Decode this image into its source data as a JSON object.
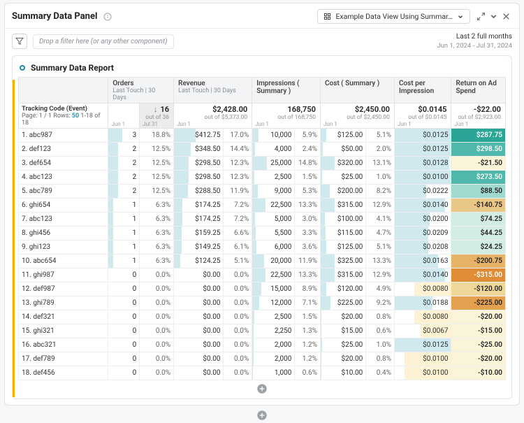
{
  "header": {
    "title": "Summary Data Panel",
    "view_btn_icon": "grid",
    "view_btn_label": "Example Data View Using Summar…"
  },
  "filter": {
    "placeholder": "Drop a filter here (or any other component)",
    "range_label": "Last 2 full months",
    "range_dates": "Jun 1, 2024 - Jul 31, 2024"
  },
  "report": {
    "title": "Summary Data Report",
    "track_label": "Tracking Code (Event)",
    "page_label_pre": "Page: 1 / 1  Rows:",
    "page_rows": "50",
    "page_label_post": "1-18 of 18",
    "sub_jun": "Jun 1",
    "sub_jul": "Jul 31"
  },
  "columns": {
    "orders": {
      "label": "Orders",
      "sub": "Last Touch | 30 Days",
      "total": "16",
      "out": "out of 36"
    },
    "revenue": {
      "label": "Revenue",
      "sub": "Last Touch | 30 Days",
      "total": "$2,428.00",
      "out": "out of $5,373.00"
    },
    "impr": {
      "label": "Impressions ( Summary )",
      "total": "168,750",
      "out": "out of 168,750"
    },
    "cost": {
      "label": "Cost ( Summary )",
      "total": "$2,450.00",
      "out": "out of $2,450.00"
    },
    "cpi": {
      "label": "Cost per Impression",
      "total": "$0.0145",
      "out": "out of $0.0145"
    },
    "roas": {
      "label": "Return on Ad Spend",
      "total": "-$22.00",
      "out": "out of $2,923.00"
    }
  },
  "rows": [
    {
      "label": "1.  abc987",
      "orders": "3",
      "orders_p": "18.8%",
      "rev": "$412.75",
      "rev_p": "17.0%",
      "imp": "10,000",
      "imp_p": "5.9%",
      "cost": "$125.00",
      "cost_p": "5.1%",
      "cpi": "$0.0125",
      "roas": "$287.75",
      "roas_c": "r-tealD",
      "bars": {
        "o": 44,
        "r": 44,
        "i": 14,
        "c": 13,
        "p": 100
      }
    },
    {
      "label": "2.  def123",
      "orders": "2",
      "orders_p": "12.5%",
      "rev": "$348.50",
      "rev_p": "14.4%",
      "imp": "4,000",
      "imp_p": "2.4%",
      "cost": "$50.00",
      "cost_p": "2.0%",
      "cpi": "$0.0125",
      "roas": "$298.50",
      "roas_c": "r-teal",
      "bars": {
        "o": 30,
        "r": 34,
        "i": 6,
        "c": 5,
        "p": 100
      }
    },
    {
      "label": "3.  def654",
      "orders": "2",
      "orders_p": "12.5%",
      "rev": "$298.50",
      "rev_p": "12.3%",
      "imp": "25,000",
      "imp_p": "14.8%",
      "cost": "$320.00",
      "cost_p": "13.1%",
      "cpi": "$0.0128",
      "roas": "-$21.50",
      "roas_c": "r-cream",
      "bars": {
        "o": 30,
        "r": 29,
        "i": 35,
        "c": 31,
        "p": 97
      }
    },
    {
      "label": "4.  abc123",
      "orders": "2",
      "orders_p": "12.5%",
      "rev": "$298.50",
      "rev_p": "12.3%",
      "imp": "2,500",
      "imp_p": "1.5%",
      "cost": "$25.00",
      "cost_p": "1.0%",
      "cpi": "$0.0100",
      "roas": "$273.50",
      "roas_c": "r-teal",
      "bars": {
        "o": 30,
        "r": 29,
        "i": 4,
        "c": 3,
        "p": 100
      }
    },
    {
      "label": "5.  abc789",
      "orders": "2",
      "orders_p": "12.5%",
      "rev": "$288.50",
      "rev_p": "11.9%",
      "imp": "9,000",
      "imp_p": "5.3%",
      "cost": "$200.00",
      "cost_p": "8.2%",
      "cpi": "$0.0222",
      "roas": "$88.50",
      "roas_c": "r-tealL",
      "bars": {
        "o": 30,
        "r": 28,
        "i": 13,
        "c": 20,
        "p": 56
      }
    },
    {
      "label": "6.  ghi654",
      "orders": "1",
      "orders_p": "6.3%",
      "rev": "$174.25",
      "rev_p": "7.2%",
      "imp": "22,500",
      "imp_p": "13.3%",
      "cost": "$315.00",
      "cost_p": "12.9%",
      "cpi": "$0.0140",
      "roas": "-$140.75",
      "roas_c": "r-tan",
      "bars": {
        "o": 15,
        "r": 17,
        "i": 31,
        "c": 31,
        "p": 89
      }
    },
    {
      "label": "7.  abc123",
      "orders": "1",
      "orders_p": "6.3%",
      "rev": "$174.25",
      "rev_p": "7.2%",
      "imp": "5,000",
      "imp_p": "3.0%",
      "cost": "$100.00",
      "cost_p": "4.1%",
      "cpi": "$0.0200",
      "roas": "$74.25",
      "roas_c": "r-mint",
      "bars": {
        "o": 15,
        "r": 17,
        "i": 7,
        "c": 10,
        "p": 62
      }
    },
    {
      "label": "8.  ghi456",
      "orders": "1",
      "orders_p": "6.3%",
      "rev": "$159.25",
      "rev_p": "6.6%",
      "imp": "5,500",
      "imp_p": "3.3%",
      "cost": "$115.00",
      "cost_p": "4.7%",
      "cpi": "$0.0209",
      "roas": "$44.25",
      "roas_c": "r-mint",
      "bars": {
        "o": 15,
        "r": 16,
        "i": 8,
        "c": 11,
        "p": 60
      }
    },
    {
      "label": "9.  ghi123",
      "orders": "1",
      "orders_p": "6.3%",
      "rev": "$149.25",
      "rev_p": "6.1%",
      "imp": "6,000",
      "imp_p": "3.6%",
      "cost": "$125.00",
      "cost_p": "5.1%",
      "cpi": "$0.0208",
      "roas": "$24.25",
      "roas_c": "r-mint",
      "bars": {
        "o": 15,
        "r": 15,
        "i": 9,
        "c": 12,
        "p": 60
      }
    },
    {
      "label": "10. abc654",
      "orders": "1",
      "orders_p": "6.3%",
      "rev": "$124.25",
      "rev_p": "5.1%",
      "imp": "20,000",
      "imp_p": "11.9%",
      "cost": "$325.00",
      "cost_p": "13.3%",
      "cpi": "$0.0163",
      "roas": "-$200.75",
      "roas_c": "r-lor",
      "bars": {
        "o": 15,
        "r": 12,
        "i": 28,
        "c": 31,
        "p": 77
      }
    },
    {
      "label": "11.  ghi987",
      "orders": "0",
      "orders_p": "0.0%",
      "rev": "$0.00",
      "rev_p": "0.0%",
      "imp": "22,500",
      "imp_p": "13.3%",
      "cost": "$315.00",
      "cost_p": "12.9%",
      "cpi": "$0.0140",
      "roas": "-$315.00",
      "roas_c": "r-orD",
      "bars": {
        "o": 0,
        "r": 0,
        "i": 31,
        "c": 31,
        "p": 89
      }
    },
    {
      "label": "12.  def987",
      "orders": "0",
      "orders_p": "0.0%",
      "rev": "$0.00",
      "rev_p": "0.0%",
      "imp": "15,000",
      "imp_p": "8.9%",
      "cost": "$120.00",
      "cost_p": "4.9%",
      "cpi": "$0.0080",
      "roas": "-$120.00",
      "roas_c": "r-sand",
      "bars": {
        "o": 0,
        "r": 0,
        "i": 21,
        "c": 12,
        "p": 100,
        "po": 35
      }
    },
    {
      "label": "13.  ghi789",
      "orders": "0",
      "orders_p": "0.0%",
      "rev": "$0.00",
      "rev_p": "0.0%",
      "imp": "12,000",
      "imp_p": "7.1%",
      "cost": "$225.00",
      "cost_p": "9.2%",
      "cpi": "$0.0188",
      "roas": "-$225.00",
      "roas_c": "r-or",
      "bars": {
        "o": 0,
        "r": 0,
        "i": 17,
        "c": 22,
        "p": 67
      }
    },
    {
      "label": "14.  def321",
      "orders": "0",
      "orders_p": "0.0%",
      "rev": "$0.00",
      "rev_p": "0.0%",
      "imp": "2,500",
      "imp_p": "1.5%",
      "cost": "$20.00",
      "cost_p": "0.8%",
      "cpi": "$0.0080",
      "roas": "-$20.00",
      "roas_c": "r-cream",
      "bars": {
        "o": 0,
        "r": 0,
        "i": 4,
        "c": 2,
        "p": 100,
        "po": 35
      }
    },
    {
      "label": "15.  ghi321",
      "orders": "0",
      "orders_p": "0.0%",
      "rev": "$0.00",
      "rev_p": "0.0%",
      "imp": "2,250",
      "imp_p": "1.3%",
      "cost": "$15.00",
      "cost_p": "0.6%",
      "cpi": "$0.0067",
      "roas": "-$15.00",
      "roas_c": "r-cream",
      "bars": {
        "o": 0,
        "r": 0,
        "i": 3,
        "c": 2,
        "p": 100,
        "po": 46
      }
    },
    {
      "label": "16.  abc321",
      "orders": "0",
      "orders_p": "0.0%",
      "rev": "$0.00",
      "rev_p": "0.0%",
      "imp": "2,000",
      "imp_p": "1.2%",
      "cost": "$25.00",
      "cost_p": "1.0%",
      "cpi": "$0.0125",
      "roas": "-$25.00",
      "roas_c": "r-cream",
      "bars": {
        "o": 0,
        "r": 0,
        "i": 3,
        "c": 3,
        "p": 100
      }
    },
    {
      "label": "17.  def789",
      "orders": "0",
      "orders_p": "0.0%",
      "rev": "$0.00",
      "rev_p": "0.0%",
      "imp": "2,000",
      "imp_p": "1.2%",
      "cost": "$20.00",
      "cost_p": "0.8%",
      "cpi": "$0.0100",
      "roas": "-$20.00",
      "roas_c": "r-cream",
      "bars": {
        "o": 0,
        "r": 0,
        "i": 3,
        "c": 2,
        "p": 100,
        "po": 18
      }
    },
    {
      "label": "18.  def456",
      "orders": "0",
      "orders_p": "0.0%",
      "rev": "$0.00",
      "rev_p": "0.0%",
      "imp": "1,000",
      "imp_p": "0.6%",
      "cost": "$10.00",
      "cost_p": "0.4%",
      "cpi": "$0.0100",
      "roas": "-$10.00",
      "roas_c": "r-cream",
      "bars": {
        "o": 0,
        "r": 0,
        "i": 2,
        "c": 1,
        "p": 100,
        "po": 18
      }
    }
  ]
}
